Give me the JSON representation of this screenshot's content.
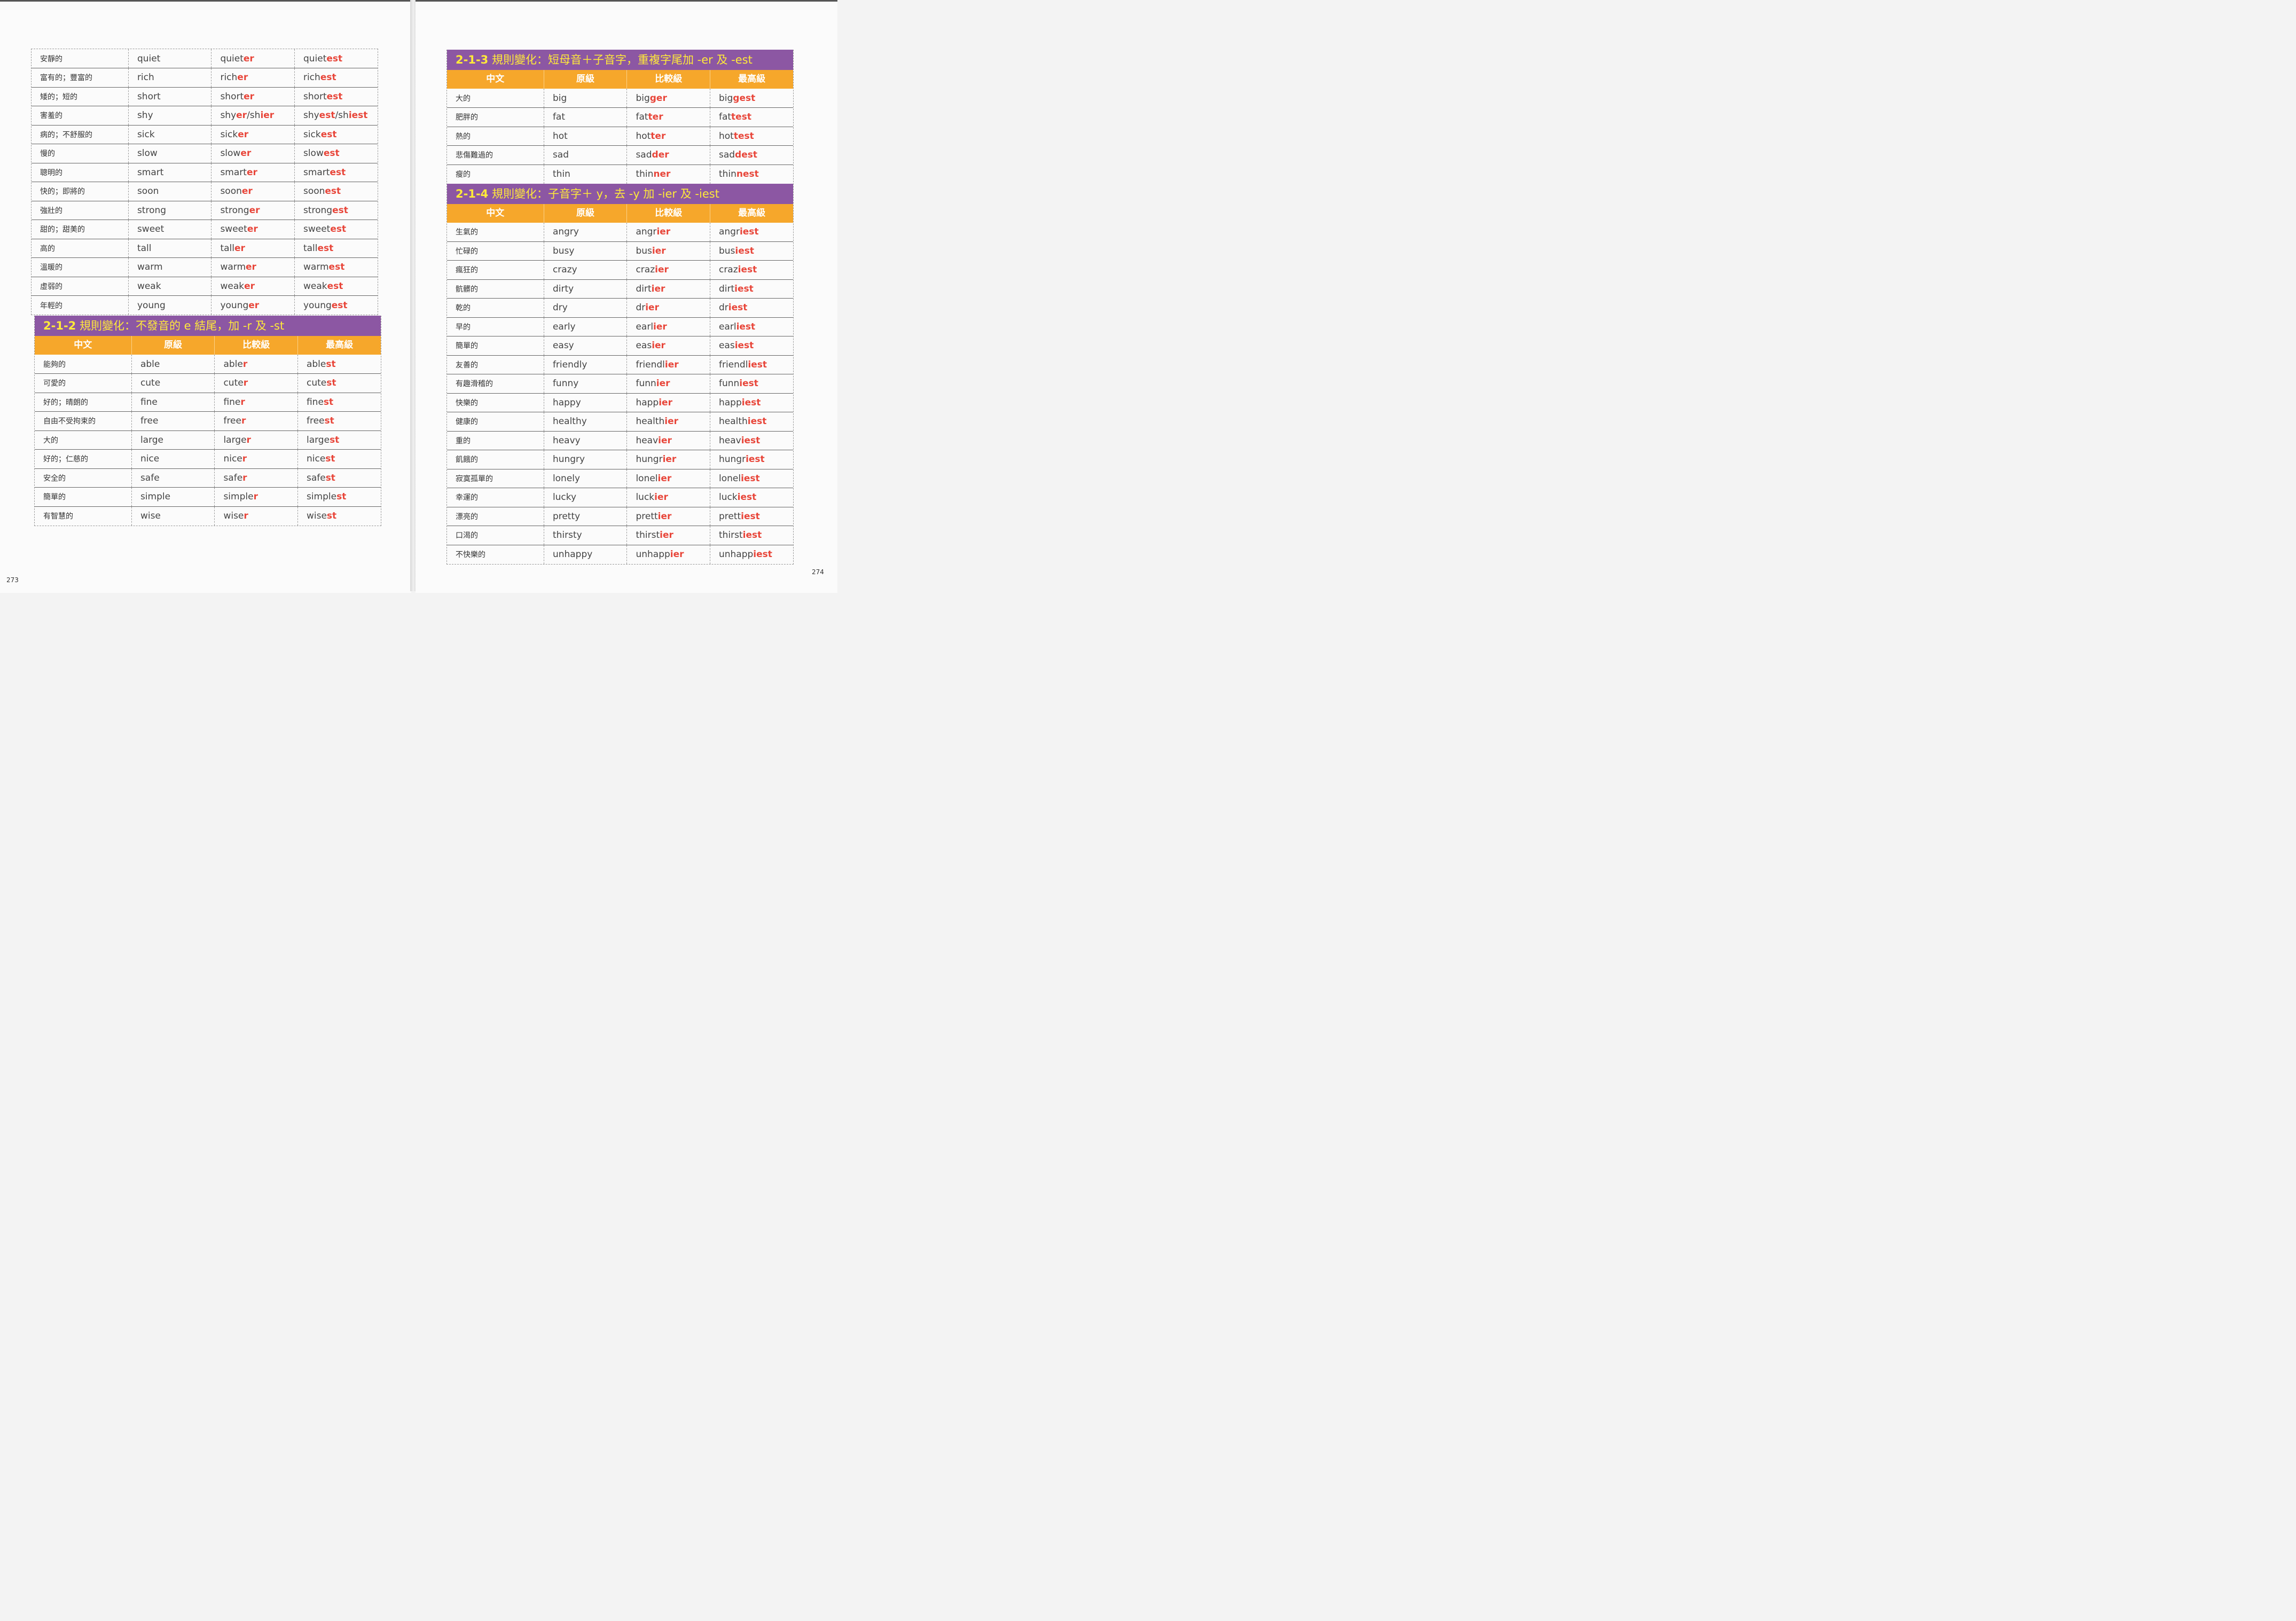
{
  "left_page": {
    "page_number": "273",
    "continued_rows": [
      {
        "zh": "安靜的",
        "base": "quiet",
        "comp": [
          [
            "quiet",
            ""
          ],
          [
            "er",
            "s"
          ]
        ],
        "sup": [
          [
            "quiet",
            ""
          ],
          [
            "est",
            "s"
          ]
        ]
      },
      {
        "zh": "富有的；豐富的",
        "base": "rich",
        "comp": [
          [
            "rich",
            ""
          ],
          [
            "er",
            "s"
          ]
        ],
        "sup": [
          [
            "rich",
            ""
          ],
          [
            "est",
            "s"
          ]
        ]
      },
      {
        "zh": "矮的；短的",
        "base": "short",
        "comp": [
          [
            "short",
            ""
          ],
          [
            "er",
            "s"
          ]
        ],
        "sup": [
          [
            "short",
            ""
          ],
          [
            "est",
            "s"
          ]
        ]
      },
      {
        "zh": "害羞的",
        "base": "shy",
        "comp": [
          [
            "shy",
            ""
          ],
          [
            "er",
            "s"
          ],
          [
            "/sh",
            ""
          ],
          [
            "ier",
            "s"
          ]
        ],
        "sup": [
          [
            "shy",
            ""
          ],
          [
            "est",
            "s"
          ],
          [
            "/sh",
            ""
          ],
          [
            "iest",
            "s"
          ]
        ]
      },
      {
        "zh": "病的；不舒服的",
        "base": "sick",
        "comp": [
          [
            "sick",
            ""
          ],
          [
            "er",
            "s"
          ]
        ],
        "sup": [
          [
            "sick",
            ""
          ],
          [
            "est",
            "s"
          ]
        ]
      },
      {
        "zh": "慢的",
        "base": "slow",
        "comp": [
          [
            "slow",
            ""
          ],
          [
            "er",
            "s"
          ]
        ],
        "sup": [
          [
            "slow",
            ""
          ],
          [
            "est",
            "s"
          ]
        ]
      },
      {
        "zh": "聰明的",
        "base": "smart",
        "comp": [
          [
            "smart",
            ""
          ],
          [
            "er",
            "s"
          ]
        ],
        "sup": [
          [
            "smart",
            ""
          ],
          [
            "est",
            "s"
          ]
        ]
      },
      {
        "zh": "快的；即將的",
        "base": "soon",
        "comp": [
          [
            "soon",
            ""
          ],
          [
            "er",
            "s"
          ]
        ],
        "sup": [
          [
            "soon",
            ""
          ],
          [
            "est",
            "s"
          ]
        ]
      },
      {
        "zh": "強壯的",
        "base": "strong",
        "comp": [
          [
            "strong",
            ""
          ],
          [
            "er",
            "s"
          ]
        ],
        "sup": [
          [
            "strong",
            ""
          ],
          [
            "est",
            "s"
          ]
        ]
      },
      {
        "zh": "甜的；甜美的",
        "base": "sweet",
        "comp": [
          [
            "sweet",
            ""
          ],
          [
            "er",
            "s"
          ]
        ],
        "sup": [
          [
            "sweet",
            ""
          ],
          [
            "est",
            "s"
          ]
        ]
      },
      {
        "zh": "高的",
        "base": "tall",
        "comp": [
          [
            "tall",
            ""
          ],
          [
            "er",
            "s"
          ]
        ],
        "sup": [
          [
            "tall",
            ""
          ],
          [
            "est",
            "s"
          ]
        ]
      },
      {
        "zh": "溫暖的",
        "base": "warm",
        "comp": [
          [
            "warm",
            ""
          ],
          [
            "er",
            "s"
          ]
        ],
        "sup": [
          [
            "warm",
            ""
          ],
          [
            "est",
            "s"
          ]
        ]
      },
      {
        "zh": "虛弱的",
        "base": "weak",
        "comp": [
          [
            "weak",
            ""
          ],
          [
            "er",
            "s"
          ]
        ],
        "sup": [
          [
            "weak",
            ""
          ],
          [
            "est",
            "s"
          ]
        ]
      },
      {
        "zh": "年輕的",
        "base": "young",
        "comp": [
          [
            "young",
            ""
          ],
          [
            "er",
            "s"
          ]
        ],
        "sup": [
          [
            "young",
            ""
          ],
          [
            "est",
            "s"
          ]
        ]
      }
    ],
    "section_212": {
      "num": "2-1-2",
      "title": "規則變化：不發音的 e 結尾，加 -r 及 -st",
      "rows": [
        {
          "zh": "能夠的",
          "base": "able",
          "comp": [
            [
              "able",
              ""
            ],
            [
              "r",
              "s"
            ]
          ],
          "sup": [
            [
              "able",
              ""
            ],
            [
              "st",
              "s"
            ]
          ]
        },
        {
          "zh": "可愛的",
          "base": "cute",
          "comp": [
            [
              "cute",
              ""
            ],
            [
              "r",
              "s"
            ]
          ],
          "sup": [
            [
              "cute",
              ""
            ],
            [
              "st",
              "s"
            ]
          ]
        },
        {
          "zh": "好的；晴朗的",
          "base": "fine",
          "comp": [
            [
              "fine",
              ""
            ],
            [
              "r",
              "s"
            ]
          ],
          "sup": [
            [
              "fine",
              ""
            ],
            [
              "st",
              "s"
            ]
          ]
        },
        {
          "zh": "自由不受拘束的",
          "base": "free",
          "comp": [
            [
              "free",
              ""
            ],
            [
              "r",
              "s"
            ]
          ],
          "sup": [
            [
              "free",
              ""
            ],
            [
              "st",
              "s"
            ]
          ]
        },
        {
          "zh": "大的",
          "base": "large",
          "comp": [
            [
              "large",
              ""
            ],
            [
              "r",
              "s"
            ]
          ],
          "sup": [
            [
              "large",
              ""
            ],
            [
              "st",
              "s"
            ]
          ]
        },
        {
          "zh": "好的；仁慈的",
          "base": "nice",
          "comp": [
            [
              "nice",
              ""
            ],
            [
              "r",
              "s"
            ]
          ],
          "sup": [
            [
              "nice",
              ""
            ],
            [
              "st",
              "s"
            ]
          ]
        },
        {
          "zh": "安全的",
          "base": "safe",
          "comp": [
            [
              "safe",
              ""
            ],
            [
              "r",
              "s"
            ]
          ],
          "sup": [
            [
              "safe",
              ""
            ],
            [
              "st",
              "s"
            ]
          ]
        },
        {
          "zh": "簡單的",
          "base": "simple",
          "comp": [
            [
              "simple",
              ""
            ],
            [
              "r",
              "s"
            ]
          ],
          "sup": [
            [
              "simple",
              ""
            ],
            [
              "st",
              "s"
            ]
          ]
        },
        {
          "zh": "有智慧的",
          "base": "wise",
          "comp": [
            [
              "wise",
              ""
            ],
            [
              "r",
              "s"
            ]
          ],
          "sup": [
            [
              "wise",
              ""
            ],
            [
              "st",
              "s"
            ]
          ]
        }
      ]
    }
  },
  "right_page": {
    "page_number": "274",
    "section_213": {
      "num": "2-1-3",
      "title": "規則變化：短母音＋子音字，重複字尾加 -er 及 -est",
      "rows": [
        {
          "zh": "大的",
          "base": "big",
          "comp": [
            [
              "big",
              ""
            ],
            [
              "ger",
              "s"
            ]
          ],
          "sup": [
            [
              "big",
              ""
            ],
            [
              "gest",
              "s"
            ]
          ]
        },
        {
          "zh": "肥胖的",
          "base": "fat",
          "comp": [
            [
              "fat",
              ""
            ],
            [
              "ter",
              "s"
            ]
          ],
          "sup": [
            [
              "fat",
              ""
            ],
            [
              "test",
              "s"
            ]
          ]
        },
        {
          "zh": "熱的",
          "base": "hot",
          "comp": [
            [
              "hot",
              ""
            ],
            [
              "ter",
              "s"
            ]
          ],
          "sup": [
            [
              "hot",
              ""
            ],
            [
              "test",
              "s"
            ]
          ]
        },
        {
          "zh": "悲傷難過的",
          "base": "sad",
          "comp": [
            [
              "sad",
              ""
            ],
            [
              "der",
              "s"
            ]
          ],
          "sup": [
            [
              "sad",
              ""
            ],
            [
              "dest",
              "s"
            ]
          ]
        },
        {
          "zh": "瘦的",
          "base": "thin",
          "comp": [
            [
              "thin",
              ""
            ],
            [
              "ner",
              "s"
            ]
          ],
          "sup": [
            [
              "thin",
              ""
            ],
            [
              "nest",
              "s"
            ]
          ]
        }
      ]
    },
    "section_214": {
      "num": "2-1-4",
      "title": "規則變化：子音字＋ y，去 -y 加 -ier 及 -iest",
      "rows": [
        {
          "zh": "生氣的",
          "base": "angry",
          "comp": [
            [
              "angr",
              ""
            ],
            [
              "ier",
              "s"
            ]
          ],
          "sup": [
            [
              "angr",
              ""
            ],
            [
              "iest",
              "s"
            ]
          ]
        },
        {
          "zh": "忙碌的",
          "base": "busy",
          "comp": [
            [
              "bus",
              ""
            ],
            [
              "ier",
              "s"
            ]
          ],
          "sup": [
            [
              "bus",
              ""
            ],
            [
              "iest",
              "s"
            ]
          ]
        },
        {
          "zh": "瘋狂的",
          "base": "crazy",
          "comp": [
            [
              "craz",
              ""
            ],
            [
              "ier",
              "s"
            ]
          ],
          "sup": [
            [
              "craz",
              ""
            ],
            [
              "iest",
              "s"
            ]
          ]
        },
        {
          "zh": "骯髒的",
          "base": "dirty",
          "comp": [
            [
              "dirt",
              ""
            ],
            [
              "ier",
              "s"
            ]
          ],
          "sup": [
            [
              "dirt",
              ""
            ],
            [
              "iest",
              "s"
            ]
          ]
        },
        {
          "zh": "乾的",
          "base": "dry",
          "comp": [
            [
              "dr",
              ""
            ],
            [
              "ier",
              "s"
            ]
          ],
          "sup": [
            [
              "dr",
              ""
            ],
            [
              "iest",
              "s"
            ]
          ]
        },
        {
          "zh": "早的",
          "base": "early",
          "comp": [
            [
              "earl",
              ""
            ],
            [
              "ier",
              "s"
            ]
          ],
          "sup": [
            [
              "earl",
              ""
            ],
            [
              "iest",
              "s"
            ]
          ]
        },
        {
          "zh": "簡單的",
          "base": "easy",
          "comp": [
            [
              "eas",
              ""
            ],
            [
              "ier",
              "s"
            ]
          ],
          "sup": [
            [
              "eas",
              ""
            ],
            [
              "iest",
              "s"
            ]
          ]
        },
        {
          "zh": "友善的",
          "base": "friendly",
          "comp": [
            [
              "friendl",
              ""
            ],
            [
              "ier",
              "s"
            ]
          ],
          "sup": [
            [
              "friendl",
              ""
            ],
            [
              "iest",
              "s"
            ]
          ]
        },
        {
          "zh": "有趣滑稽的",
          "base": "funny",
          "comp": [
            [
              "funn",
              ""
            ],
            [
              "ier",
              "s"
            ]
          ],
          "sup": [
            [
              "funn",
              ""
            ],
            [
              "iest",
              "s"
            ]
          ]
        },
        {
          "zh": "快樂的",
          "base": "happy",
          "comp": [
            [
              "happ",
              ""
            ],
            [
              "ier",
              "s"
            ]
          ],
          "sup": [
            [
              "happ",
              ""
            ],
            [
              "iest",
              "s"
            ]
          ]
        },
        {
          "zh": "健康的",
          "base": "healthy",
          "comp": [
            [
              "health",
              ""
            ],
            [
              "ier",
              "s"
            ]
          ],
          "sup": [
            [
              "health",
              ""
            ],
            [
              "iest",
              "s"
            ]
          ]
        },
        {
          "zh": "重的",
          "base": "heavy",
          "comp": [
            [
              "heav",
              ""
            ],
            [
              "ier",
              "s"
            ]
          ],
          "sup": [
            [
              "heav",
              ""
            ],
            [
              "iest",
              "s"
            ]
          ]
        },
        {
          "zh": "飢餓的",
          "base": "hungry",
          "comp": [
            [
              "hungr",
              ""
            ],
            [
              "ier",
              "s"
            ]
          ],
          "sup": [
            [
              "hungr",
              ""
            ],
            [
              "iest",
              "s"
            ]
          ]
        },
        {
          "zh": "寂寞孤單的",
          "base": "lonely",
          "comp": [
            [
              "lonel",
              ""
            ],
            [
              "ier",
              "s"
            ]
          ],
          "sup": [
            [
              "lonel",
              ""
            ],
            [
              "iest",
              "s"
            ]
          ]
        },
        {
          "zh": "幸運的",
          "base": "lucky",
          "comp": [
            [
              "luck",
              ""
            ],
            [
              "ier",
              "s"
            ]
          ],
          "sup": [
            [
              "luck",
              ""
            ],
            [
              "iest",
              "s"
            ]
          ]
        },
        {
          "zh": "漂亮的",
          "base": "pretty",
          "comp": [
            [
              "prett",
              ""
            ],
            [
              "ier",
              "s"
            ]
          ],
          "sup": [
            [
              "prett",
              ""
            ],
            [
              "iest",
              "s"
            ]
          ]
        },
        {
          "zh": "口渴的",
          "base": "thirsty",
          "comp": [
            [
              "thirst",
              ""
            ],
            [
              "ier",
              "s"
            ]
          ],
          "sup": [
            [
              "thirst",
              ""
            ],
            [
              "iest",
              "s"
            ]
          ]
        },
        {
          "zh": "不快樂的",
          "base": "unhappy",
          "comp": [
            [
              "unhapp",
              ""
            ],
            [
              "ier",
              "s"
            ]
          ],
          "sup": [
            [
              "unhapp",
              ""
            ],
            [
              "iest",
              "s"
            ]
          ]
        }
      ]
    }
  },
  "table_headers": [
    "中文",
    "原級",
    "比較級",
    "最高級"
  ],
  "colors": {
    "title_bg": "#8c57a3",
    "title_text": "#ffea39",
    "header_bg": "#f6a72b",
    "suffix": "#e8463a"
  }
}
